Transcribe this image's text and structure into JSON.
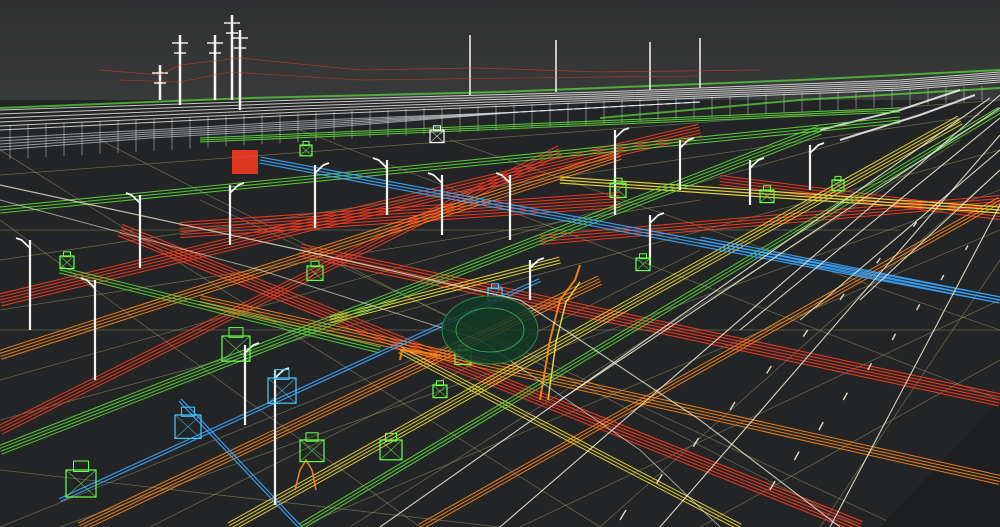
{
  "scene": {
    "kind": "3d-wireframe-render",
    "background_sky": "#303132",
    "background_ground": "#242527",
    "colors": {
      "road_lines": "#f2f2dc",
      "grid_lines": "#9a9a6a",
      "red_utility": "#ff3b1e",
      "orange_utility": "#ff8a1a",
      "yellow_utility": "#f4e23a",
      "green_utility": "#5edc3a",
      "blue_utility": "#3aa6ff",
      "structure_white": "#ffffff",
      "manhole_green": "#6cff4a",
      "manhole_cyan": "#49c8ff"
    },
    "elements": {
      "bridge": "bridge-structure",
      "utility_poles": "utility-pole",
      "street_lights": "street-light",
      "manholes": "manhole-chamber",
      "underground_tank": "underground-tank"
    }
  }
}
